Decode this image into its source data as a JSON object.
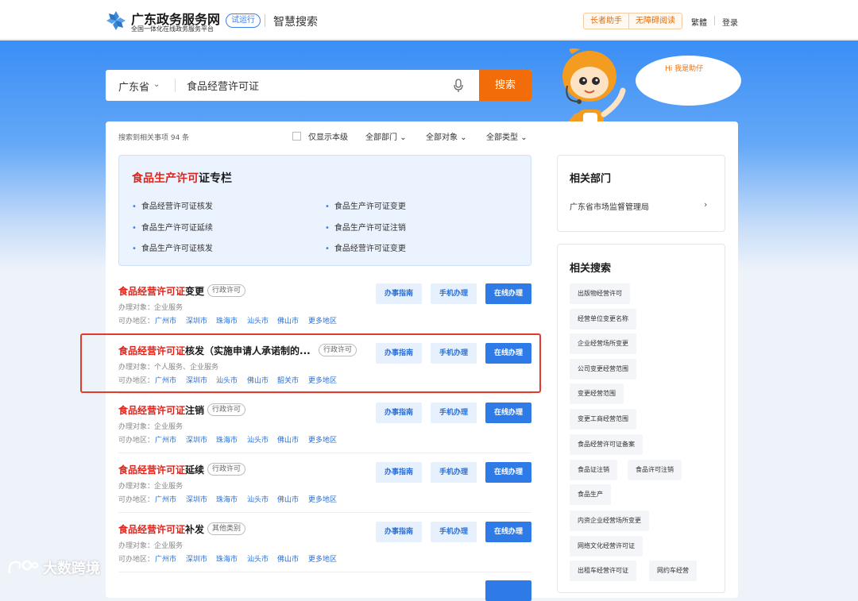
{
  "header": {
    "brand": "广东政务服务网",
    "brand_sub": "全国一体化在线政务服务平台",
    "trial": "试运行",
    "section": "智慧搜索",
    "tools": [
      "长者助手",
      "无障碍阅读"
    ],
    "traditional": "繁體",
    "login": "登录"
  },
  "search": {
    "province": "广东省",
    "query": "食品经营许可证",
    "button": "搜索"
  },
  "assistant": {
    "greeting": "Hi 我是助仔"
  },
  "filters": {
    "count": "搜索到相关事项 94 条",
    "only_level": "仅显示本级",
    "dept": "全部部门",
    "target": "全部对象",
    "type": "全部类型"
  },
  "special": {
    "title_hl": "食品生产许可",
    "title_rest": "证专栏",
    "items": [
      "食品经营许可证核发",
      "食品生产许可证变更",
      "食品生产许可证延续",
      "食品生产许可证注销",
      "食品生产许可证核发",
      "食品经营许可证变更"
    ]
  },
  "results": [
    {
      "hl": "食品经营许可证",
      "rest": "变更",
      "tag": "行政许可",
      "obj": "办理对象：企业服务",
      "area_label": "可办地区：",
      "cities": [
        "广州市",
        "深圳市",
        "珠海市",
        "汕头市",
        "佛山市",
        "更多地区"
      ]
    },
    {
      "hl": "食品经营许可证",
      "rest": "核发（实施申请人承诺制的...",
      "tag": "行政许可",
      "obj": "办理对象：个人服务、企业服务",
      "area_label": "可办地区：",
      "cities": [
        "广州市",
        "深圳市",
        "汕头市",
        "佛山市",
        "韶关市",
        "更多地区"
      ]
    },
    {
      "hl": "食品经营许可证",
      "rest": "注销",
      "tag": "行政许可",
      "obj": "办理对象：企业服务",
      "area_label": "可办地区：",
      "cities": [
        "广州市",
        "深圳市",
        "珠海市",
        "汕头市",
        "佛山市",
        "更多地区"
      ]
    },
    {
      "hl": "食品经营许可证",
      "rest": "延续",
      "tag": "行政许可",
      "obj": "办理对象：企业服务",
      "area_label": "可办地区：",
      "cities": [
        "广州市",
        "深圳市",
        "珠海市",
        "汕头市",
        "佛山市",
        "更多地区"
      ]
    },
    {
      "hl": "食品经营许可证",
      "rest": "补发",
      "tag": "其他类别",
      "obj": "办理对象：企业服务",
      "area_label": "可办地区：",
      "cities": [
        "广州市",
        "深圳市",
        "珠海市",
        "汕头市",
        "佛山市",
        "更多地区"
      ]
    }
  ],
  "buttons": {
    "guide": "办事指南",
    "mobile": "手机办理",
    "online": "在线办理"
  },
  "dept_panel": {
    "title": "相关部门",
    "item": "广东省市场监督管理局"
  },
  "related": {
    "title": "相关搜索",
    "tags": [
      "出版物经营许可",
      "经营单位变更名称",
      "企业经营场所变更",
      "公司变更经营范围",
      "变更经营范围",
      "变更工商经营范围",
      "食品经营许可证备案",
      "食品证注销",
      "食品许可注销",
      "食品生产",
      "内资企业经营场所变更",
      "网络文化经营许可证",
      "出租车经营许可证",
      "网约车经营"
    ]
  },
  "watermark": "大数跨境",
  "colors": {
    "primary": "#2e7ae6",
    "accent": "#f26d0a",
    "highlight": "#e2231a"
  }
}
